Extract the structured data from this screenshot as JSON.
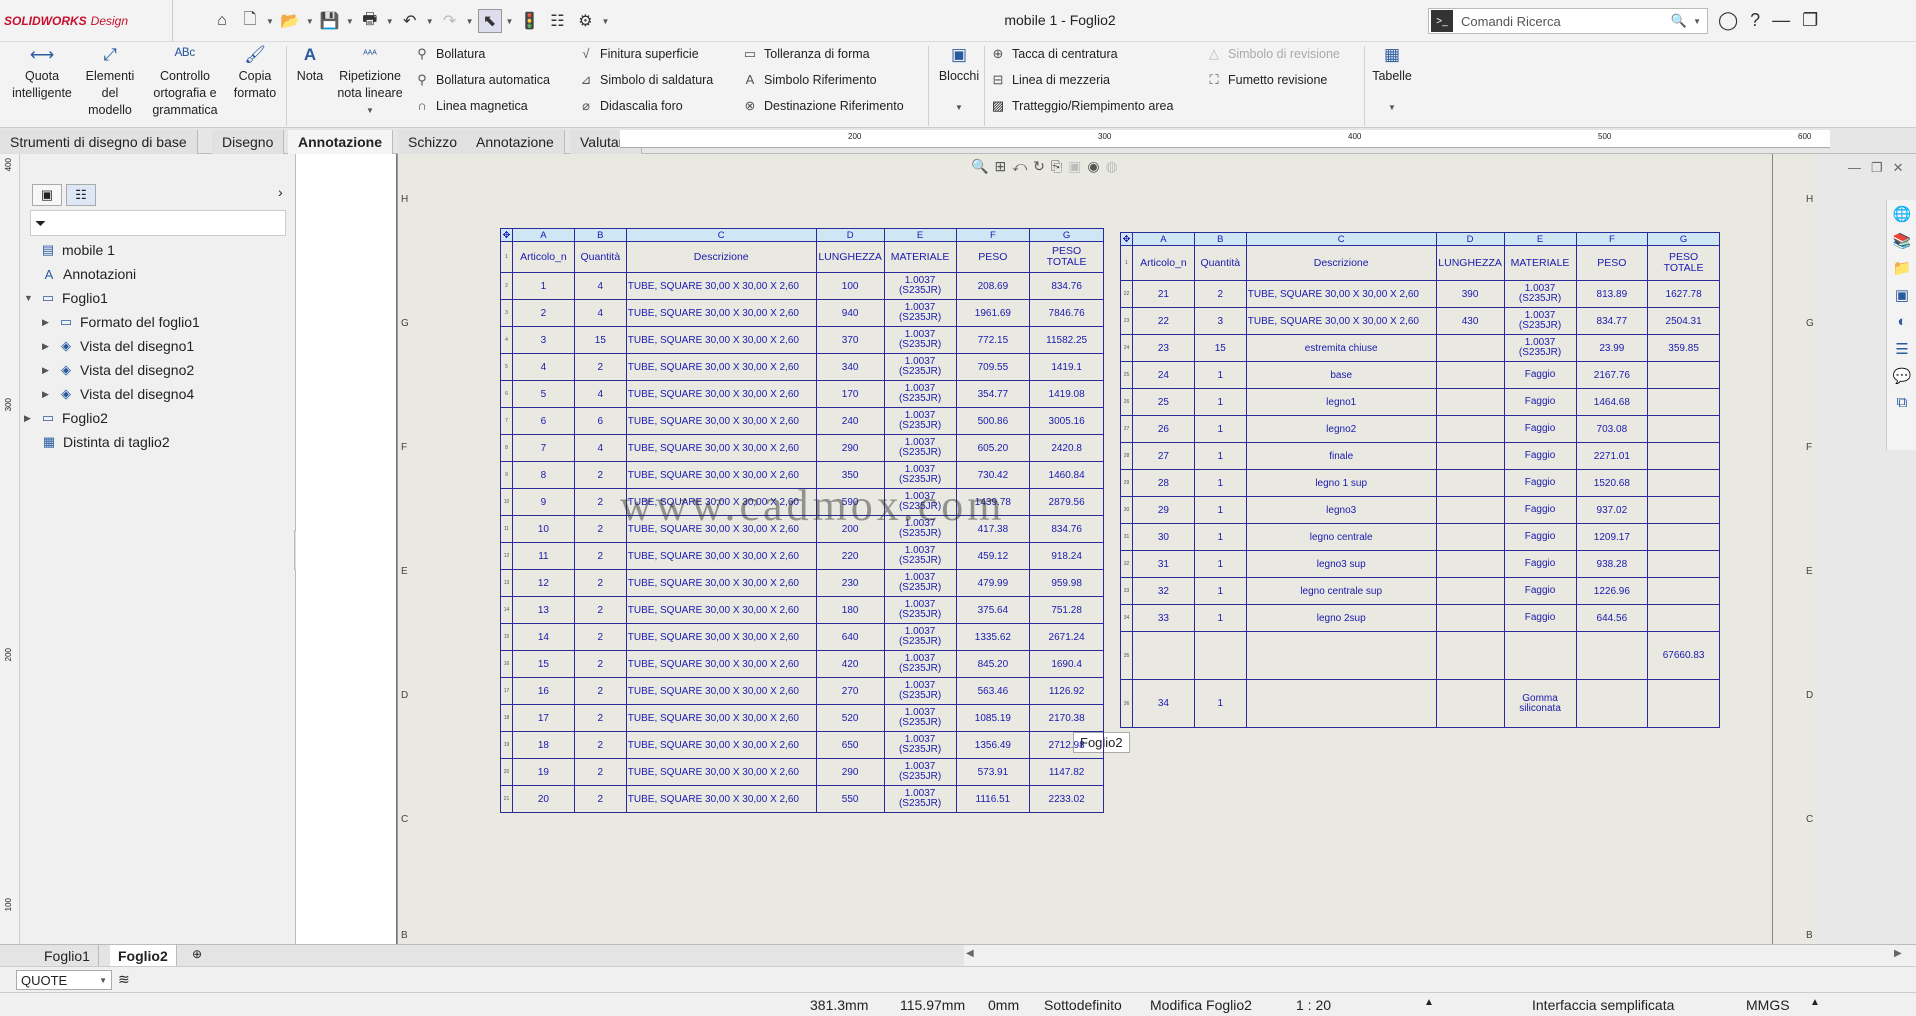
{
  "app": {
    "brand": "SOLIDWORKS",
    "product": "Design",
    "window_title": "mobile 1 - Foglio2",
    "search_placeholder": "Comandi Ricerca"
  },
  "ribbon": {
    "big": [
      {
        "label": "Quota\nintelligente",
        "icon": "smart-dimension-icon"
      },
      {
        "label": "Elementi\ndel\nmodello",
        "icon": "model-items-icon"
      },
      {
        "label": "Controllo\nortografia e\ngrammatica",
        "icon": "spell-check-icon"
      },
      {
        "label": "Copia\nformato",
        "icon": "format-painter-icon"
      },
      {
        "label": "Nota",
        "icon": "note-icon"
      },
      {
        "label": "Ripetizione\nnota lineare",
        "icon": "linear-note-pattern-icon"
      }
    ],
    "col1": [
      "Bollatura",
      "Bollatura automatica",
      "Linea magnetica"
    ],
    "col2": [
      "Finitura superficie",
      "Simbolo di saldatura",
      "Didascalia foro"
    ],
    "col3": [
      "Tolleranza di forma",
      "Simbolo Riferimento",
      "Destinazione Riferimento"
    ],
    "blocchi": "Blocchi",
    "col4": [
      "Tacca di centratura",
      "Linea di mezzeria",
      "Tratteggio/Riempimento area"
    ],
    "col5": [
      "Simbolo di revisione",
      "Fumetto revisione"
    ],
    "tabelle": "Tabelle"
  },
  "tabs": [
    "Strumenti di disegno di base",
    "Disegno",
    "Annotazione",
    "Schizzo",
    "Annotazione",
    "Valutare"
  ],
  "tree": {
    "items": [
      "mobile 1",
      "Annotazioni",
      "Foglio1",
      "Formato del foglio1",
      "Vista del disegno1",
      "Vista del disegno2",
      "Vista del disegno4",
      "Foglio2",
      "Distinta di taglio2"
    ]
  },
  "sheet": {
    "letters": [
      "H",
      "G",
      "F",
      "E",
      "D",
      "C",
      "B"
    ],
    "ruler_marks": [
      "200",
      "300",
      "400",
      "500",
      "600"
    ],
    "vruler_marks": [
      "400",
      "300",
      "200",
      "100"
    ],
    "label": "Foglio2",
    "watermark": "www.cadmox.com"
  },
  "table_headers": {
    "letters": [
      "A",
      "B",
      "C",
      "D",
      "E",
      "F",
      "G"
    ],
    "columns": [
      "Articolo_n",
      "Quantità",
      "Descrizione",
      "LUNGHEZZA",
      "MATERIALE",
      "PESO",
      "PESO\nTOTALE"
    ]
  },
  "table1_rows": [
    [
      "1",
      "4",
      "TUBE, SQUARE 30,00 X 30,00 X 2,60",
      "100",
      "1.0037\n(S235JR)",
      "208.69",
      "834.76"
    ],
    [
      "2",
      "4",
      "TUBE, SQUARE 30,00 X 30,00 X 2,60",
      "940",
      "1.0037\n(S235JR)",
      "1961.69",
      "7846.76"
    ],
    [
      "3",
      "15",
      "TUBE, SQUARE 30,00 X 30,00 X 2,60",
      "370",
      "1.0037\n(S235JR)",
      "772.15",
      "11582.25"
    ],
    [
      "4",
      "2",
      "TUBE, SQUARE 30,00 X 30,00 X 2,60",
      "340",
      "1.0037\n(S235JR)",
      "709.55",
      "1419.1"
    ],
    [
      "5",
      "4",
      "TUBE, SQUARE 30,00 X 30,00 X 2,60",
      "170",
      "1.0037\n(S235JR)",
      "354.77",
      "1419.08"
    ],
    [
      "6",
      "6",
      "TUBE, SQUARE 30,00 X 30,00 X 2,60",
      "240",
      "1.0037\n(S235JR)",
      "500.86",
      "3005.16"
    ],
    [
      "7",
      "4",
      "TUBE, SQUARE 30,00 X 30,00 X 2,60",
      "290",
      "1.0037\n(S235JR)",
      "605.20",
      "2420.8"
    ],
    [
      "8",
      "2",
      "TUBE, SQUARE 30,00 X 30,00 X 2,60",
      "350",
      "1.0037\n(S235JR)",
      "730.42",
      "1460.84"
    ],
    [
      "9",
      "2",
      "TUBE, SQUARE 30,00 X 30,00 X 2,60",
      "590",
      "1.0037\n(S235JR)",
      "1439.78",
      "2879.56"
    ],
    [
      "10",
      "2",
      "TUBE, SQUARE 30,00 X 30,00 X 2,60",
      "200",
      "1.0037\n(S235JR)",
      "417.38",
      "834.76"
    ],
    [
      "11",
      "2",
      "TUBE, SQUARE 30,00 X 30,00 X 2,60",
      "220",
      "1.0037\n(S235JR)",
      "459.12",
      "918.24"
    ],
    [
      "12",
      "2",
      "TUBE, SQUARE 30,00 X 30,00 X 2,60",
      "230",
      "1.0037\n(S235JR)",
      "479.99",
      "959.98"
    ],
    [
      "13",
      "2",
      "TUBE, SQUARE 30,00 X 30,00 X 2,60",
      "180",
      "1.0037\n(S235JR)",
      "375.64",
      "751.28"
    ],
    [
      "14",
      "2",
      "TUBE, SQUARE 30,00 X 30,00 X 2,60",
      "640",
      "1.0037\n(S235JR)",
      "1335.62",
      "2671.24"
    ],
    [
      "15",
      "2",
      "TUBE, SQUARE 30,00 X 30,00 X 2,60",
      "420",
      "1.0037\n(S235JR)",
      "845.20",
      "1690.4"
    ],
    [
      "16",
      "2",
      "TUBE, SQUARE 30,00 X 30,00 X 2,60",
      "270",
      "1.0037\n(S235JR)",
      "563.46",
      "1126.92"
    ],
    [
      "17",
      "2",
      "TUBE, SQUARE 30,00 X 30,00 X 2,60",
      "520",
      "1.0037\n(S235JR)",
      "1085.19",
      "2170.38"
    ],
    [
      "18",
      "2",
      "TUBE, SQUARE 30,00 X 30,00 X 2,60",
      "650",
      "1.0037\n(S235JR)",
      "1356.49",
      "2712.98"
    ],
    [
      "19",
      "2",
      "TUBE, SQUARE 30,00 X 30,00 X 2,60",
      "290",
      "1.0037\n(S235JR)",
      "573.91",
      "1147.82"
    ],
    [
      "20",
      "2",
      "TUBE, SQUARE 30,00 X 30,00 X 2,60",
      "550",
      "1.0037\n(S235JR)",
      "1116.51",
      "2233.02"
    ]
  ],
  "table2_rows": [
    [
      "21",
      "2",
      "TUBE, SQUARE 30,00 X 30,00 X 2,60",
      "390",
      "1.0037\n(S235JR)",
      "813.89",
      "1627.78"
    ],
    [
      "22",
      "3",
      "TUBE, SQUARE 30,00 X 30,00 X 2,60",
      "430",
      "1.0037\n(S235JR)",
      "834.77",
      "2504.31"
    ],
    [
      "23",
      "15",
      "estremita chiuse",
      "",
      "1.0037\n(S235JR)",
      "23.99",
      "359.85"
    ],
    [
      "24",
      "1",
      "base",
      "",
      "Faggio",
      "2167.76",
      ""
    ],
    [
      "25",
      "1",
      "legno1",
      "",
      "Faggio",
      "1464.68",
      ""
    ],
    [
      "26",
      "1",
      "legno2",
      "",
      "Faggio",
      "703.08",
      ""
    ],
    [
      "27",
      "1",
      "finale",
      "",
      "Faggio",
      "2271.01",
      ""
    ],
    [
      "28",
      "1",
      "legno 1 sup",
      "",
      "Faggio",
      "1520.68",
      ""
    ],
    [
      "29",
      "1",
      "legno3",
      "",
      "Faggio",
      "937.02",
      ""
    ],
    [
      "30",
      "1",
      "legno centrale",
      "",
      "Faggio",
      "1209.17",
      ""
    ],
    [
      "31",
      "1",
      "legno3 sup",
      "",
      "Faggio",
      "938.28",
      ""
    ],
    [
      "32",
      "1",
      "legno centrale sup",
      "",
      "Faggio",
      "1226.96",
      ""
    ],
    [
      "33",
      "1",
      "legno 2sup",
      "",
      "Faggio",
      "644.56",
      ""
    ],
    [
      "",
      "",
      "",
      "",
      "",
      "",
      "67660.83"
    ],
    [
      "34",
      "1",
      "",
      "",
      "Gomma\nsiliconata",
      "",
      ""
    ]
  ],
  "sheet_tabs": [
    "Foglio1",
    "Foglio2"
  ],
  "quote_select": "QUOTE",
  "status": {
    "x": "381.3mm",
    "y": "115.97mm",
    "z": "0mm",
    "state": "Sottodefinito",
    "edit": "Modifica Foglio2",
    "scale": "1 : 20",
    "ui": "Interfaccia semplificata",
    "units": "MMGS"
  }
}
